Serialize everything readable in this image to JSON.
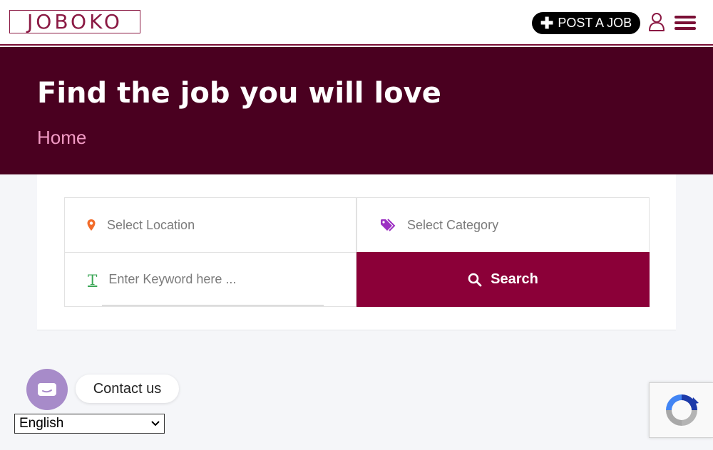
{
  "header": {
    "logo_text": "JOBOKO",
    "post_job_label": "POST A JOB",
    "post_job_icon": "plus-icon",
    "user_icon": "user-icon",
    "menu_icon": "hamburger-menu-icon",
    "brand_color": "#8b1a44"
  },
  "hero": {
    "title": "Find the job you will love",
    "breadcrumb": "Home",
    "background_color": "#4a0020",
    "breadcrumb_color": "#f19ac4"
  },
  "search": {
    "location_placeholder": "Select Location",
    "category_placeholder": "Select Category",
    "keyword_placeholder": "Enter Keyword here ...",
    "keyword_icon_glyph": "T",
    "search_label": "Search",
    "search_button_color": "#8b0038",
    "location_icon": "map-pin-icon",
    "category_icon": "tags-icon",
    "keyword_icon": "text-icon",
    "search_icon": "search-icon"
  },
  "chat": {
    "label": "Contact us",
    "icon": "chat-icon"
  },
  "language": {
    "selected": "English"
  },
  "recaptcha": {
    "icon": "recaptcha-icon"
  }
}
